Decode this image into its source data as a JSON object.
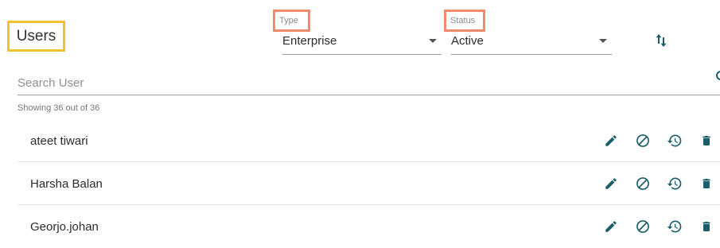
{
  "page": {
    "title": "Users"
  },
  "filters": {
    "type": {
      "label": "Type",
      "value": "Enterprise"
    },
    "status": {
      "label": "Status",
      "value": "Active"
    }
  },
  "sort": {
    "icon": "sort-arrows-icon"
  },
  "search": {
    "placeholder": "Search User",
    "icon": "search-icon"
  },
  "summary": {
    "count_text": "Showing 36 out of 36"
  },
  "users": [
    {
      "name": "ateet tiwari"
    },
    {
      "name": "Harsha Balan"
    },
    {
      "name": "Georjo.johan"
    }
  ],
  "row_action_icons": [
    "edit-icon",
    "block-icon",
    "restore-icon",
    "delete-icon"
  ],
  "colors": {
    "accent_teal": "#1b5e6b",
    "title_highlight": "#f2c12e",
    "filter_label_highlight": "#ef8b6a"
  }
}
